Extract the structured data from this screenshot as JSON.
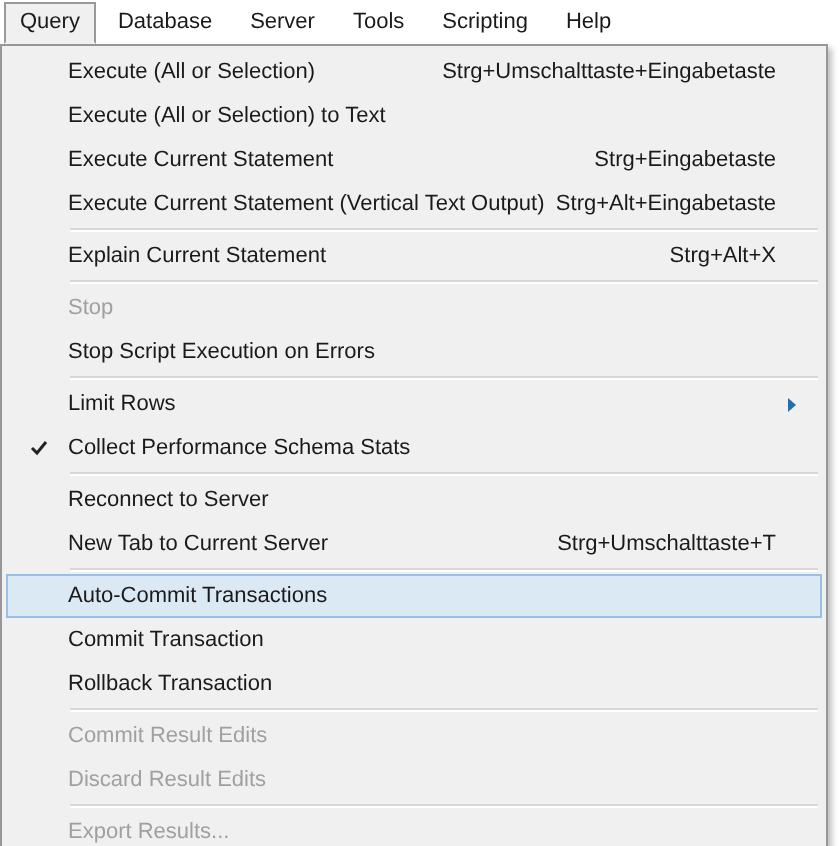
{
  "menu_bar": [
    {
      "label": "Query",
      "selected": true
    },
    {
      "label": "Database",
      "selected": false
    },
    {
      "label": "Server",
      "selected": false
    },
    {
      "label": "Tools",
      "selected": false
    },
    {
      "label": "Scripting",
      "selected": false
    },
    {
      "label": "Help",
      "selected": false
    }
  ],
  "menu": {
    "sections": [
      [
        {
          "label": "Execute (All or Selection)",
          "shortcut": "Strg+Umschalttaste+Eingabetaste",
          "disabled": false,
          "checked": false,
          "selected": false,
          "submenu": false
        },
        {
          "label": "Execute (All or Selection) to Text",
          "disabled": false,
          "checked": false,
          "selected": false,
          "submenu": false
        },
        {
          "label": "Execute Current Statement",
          "shortcut": "Strg+Eingabetaste",
          "disabled": false,
          "checked": false,
          "selected": false,
          "submenu": false
        },
        {
          "label": "Execute Current Statement (Vertical Text Output)",
          "shortcut": "Strg+Alt+Eingabetaste",
          "disabled": false,
          "checked": false,
          "selected": false,
          "submenu": false
        }
      ],
      [
        {
          "label": "Explain Current Statement",
          "shortcut": "Strg+Alt+X",
          "disabled": false,
          "checked": false,
          "selected": false,
          "submenu": false
        }
      ],
      [
        {
          "label": "Stop",
          "disabled": true,
          "checked": false,
          "selected": false,
          "submenu": false
        },
        {
          "label": "Stop Script Execution on Errors",
          "disabled": false,
          "checked": false,
          "selected": false,
          "submenu": false
        }
      ],
      [
        {
          "label": "Limit Rows",
          "disabled": false,
          "checked": false,
          "selected": false,
          "submenu": true
        },
        {
          "label": "Collect Performance Schema Stats",
          "disabled": false,
          "checked": true,
          "selected": false,
          "submenu": false
        }
      ],
      [
        {
          "label": "Reconnect to Server",
          "disabled": false,
          "checked": false,
          "selected": false,
          "submenu": false
        },
        {
          "label": "New Tab to Current Server",
          "shortcut": "Strg+Umschalttaste+T",
          "disabled": false,
          "checked": false,
          "selected": false,
          "submenu": false
        }
      ],
      [
        {
          "label": "Auto-Commit Transactions",
          "disabled": false,
          "checked": false,
          "selected": true,
          "submenu": false
        },
        {
          "label": "Commit Transaction",
          "disabled": false,
          "checked": false,
          "selected": false,
          "submenu": false
        },
        {
          "label": "Rollback Transaction",
          "disabled": false,
          "checked": false,
          "selected": false,
          "submenu": false
        }
      ],
      [
        {
          "label": "Commit Result Edits",
          "disabled": true,
          "checked": false,
          "selected": false,
          "submenu": false
        },
        {
          "label": "Discard Result Edits",
          "disabled": true,
          "checked": false,
          "selected": false,
          "submenu": false
        }
      ],
      [
        {
          "label": "Export Results...",
          "disabled": true,
          "checked": false,
          "selected": false,
          "submenu": false
        }
      ]
    ]
  }
}
